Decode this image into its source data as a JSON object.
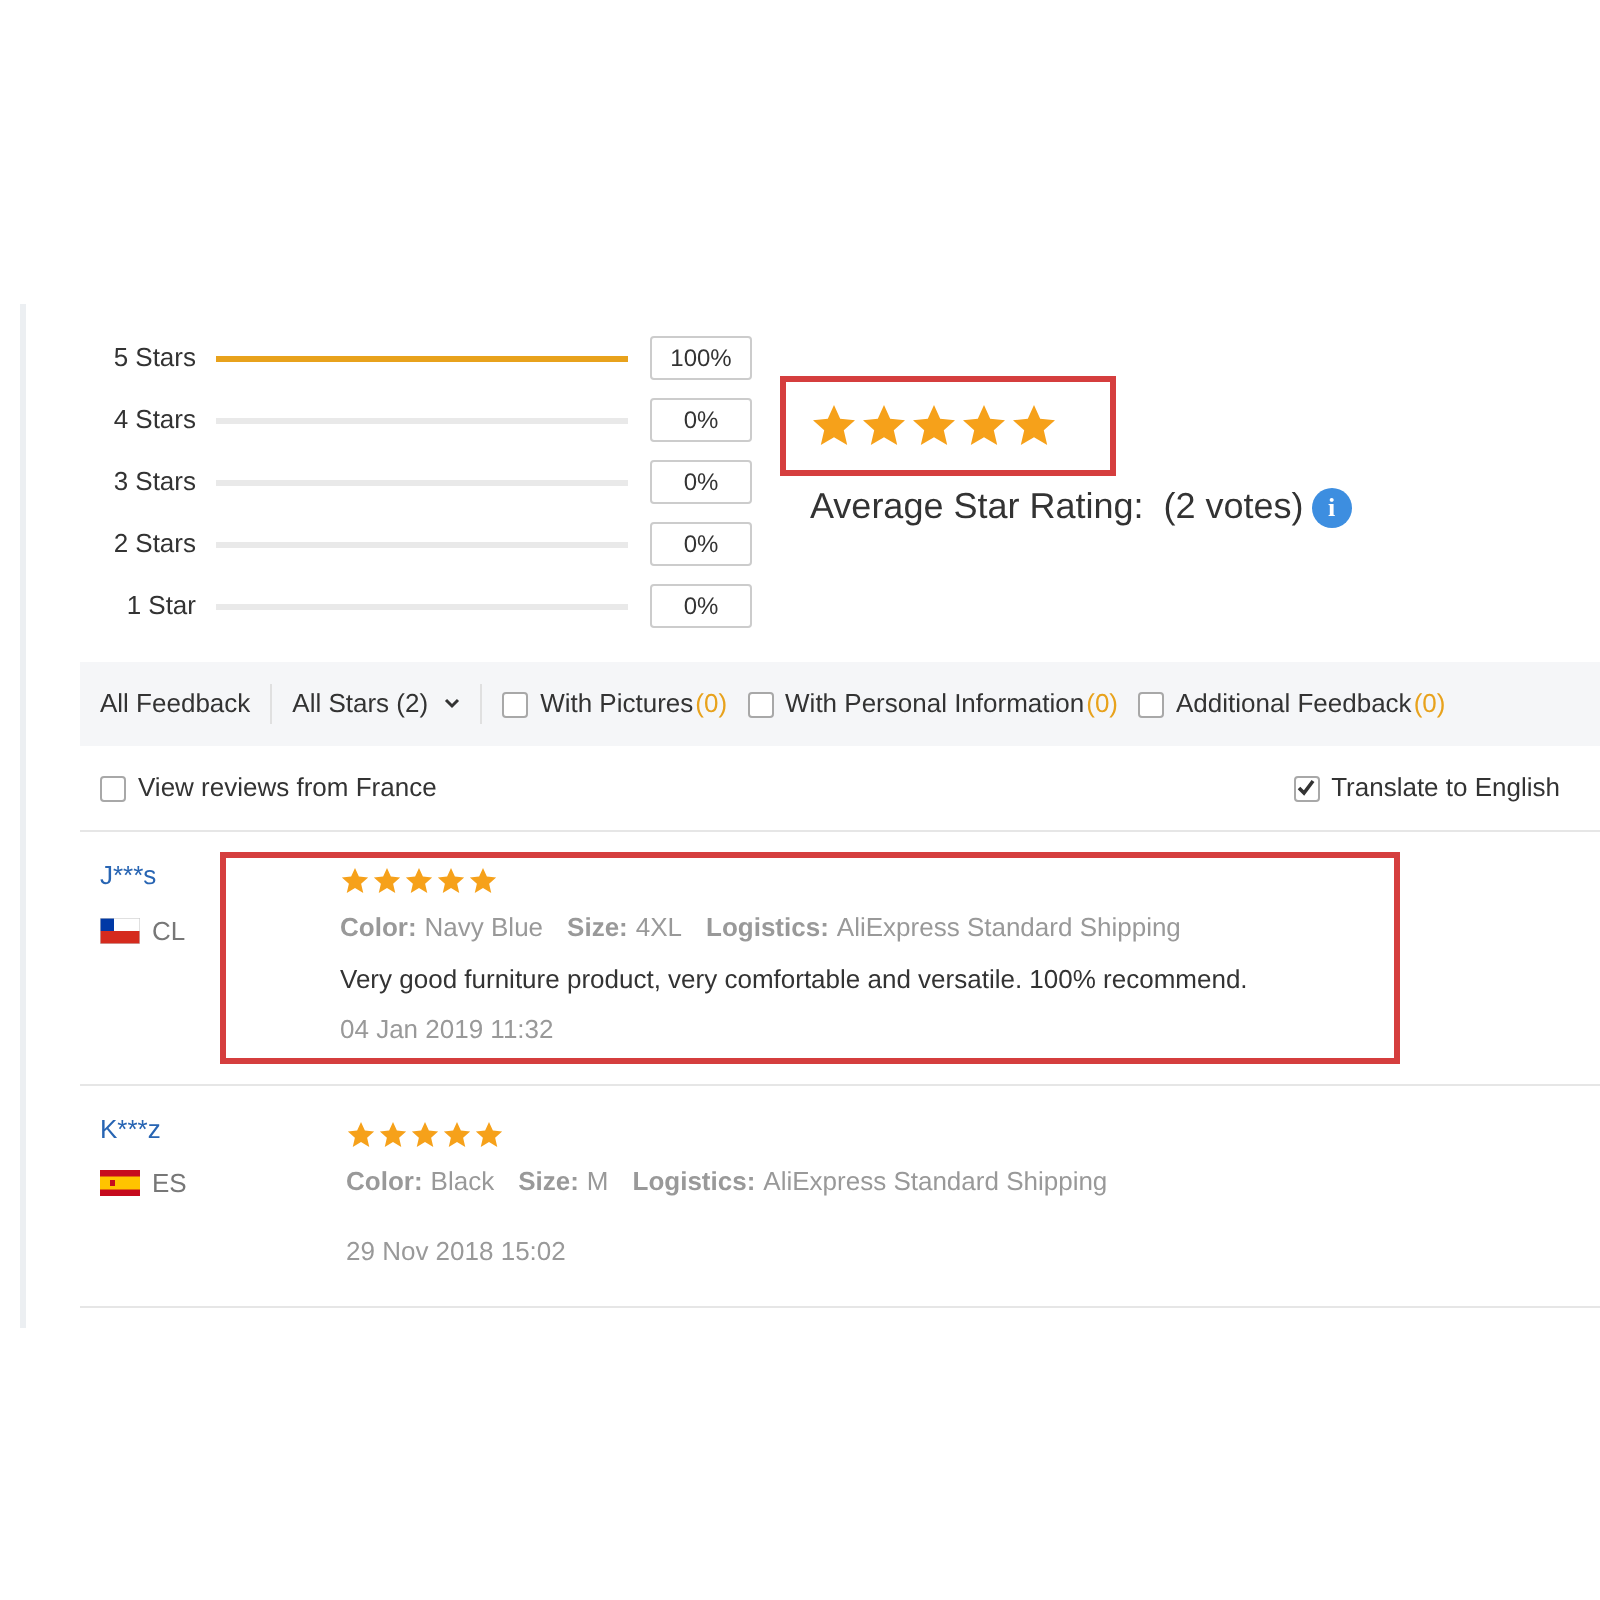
{
  "breakdown": [
    {
      "label": "5 Stars",
      "level": 1,
      "percent": "100%"
    },
    {
      "label": "4 Stars",
      "level": 0,
      "percent": "0%"
    },
    {
      "label": "3 Stars",
      "level": 0,
      "percent": "0%"
    },
    {
      "label": "2 Stars",
      "level": 0,
      "percent": "0%"
    },
    {
      "label": "1 Star",
      "level": 0,
      "percent": "0%"
    }
  ],
  "average": {
    "stars": 5,
    "highlighted": true,
    "label": "Average Star Rating:",
    "votes": "(2 votes)",
    "info": "i"
  },
  "filter_bar": {
    "all_feedback": "All Feedback",
    "star_filter": "All Stars (2)",
    "options": [
      {
        "label": "With Pictures",
        "count": "(0)",
        "checked": false
      },
      {
        "label": "With Personal Information",
        "count": "(0)",
        "checked": false
      },
      {
        "label": "Additional Feedback",
        "count": "(0)",
        "checked": false
      }
    ]
  },
  "country_filter": {
    "label": "View reviews from France",
    "checked": false
  },
  "translate": {
    "label": "Translate to English",
    "checked": true
  },
  "reviews": [
    {
      "user": "J***s",
      "flag": {
        "kind": "cl"
      },
      "country": "CL",
      "stars": 5,
      "highlighted": true,
      "attributes": [
        {
          "name": "Color:",
          "value": "Navy Blue"
        },
        {
          "name": "Size:",
          "value": "4XL"
        },
        {
          "name": "Logistics:",
          "value": "AliExpress Standard Shipping"
        }
      ],
      "text": "Very good furniture product, very comfortable and versatile. 100% recommend.",
      "date": "04 Jan 2019 11:32"
    },
    {
      "user": "K***z",
      "flag": {
        "kind": "es"
      },
      "country": "ES",
      "stars": 5,
      "highlighted": false,
      "attributes": [
        {
          "name": "Color:",
          "value": "Black"
        },
        {
          "name": "Size:",
          "value": "M"
        },
        {
          "name": "Logistics:",
          "value": "AliExpress Standard Shipping"
        }
      ],
      "date": "29 Nov 2018 15:02"
    }
  ]
}
